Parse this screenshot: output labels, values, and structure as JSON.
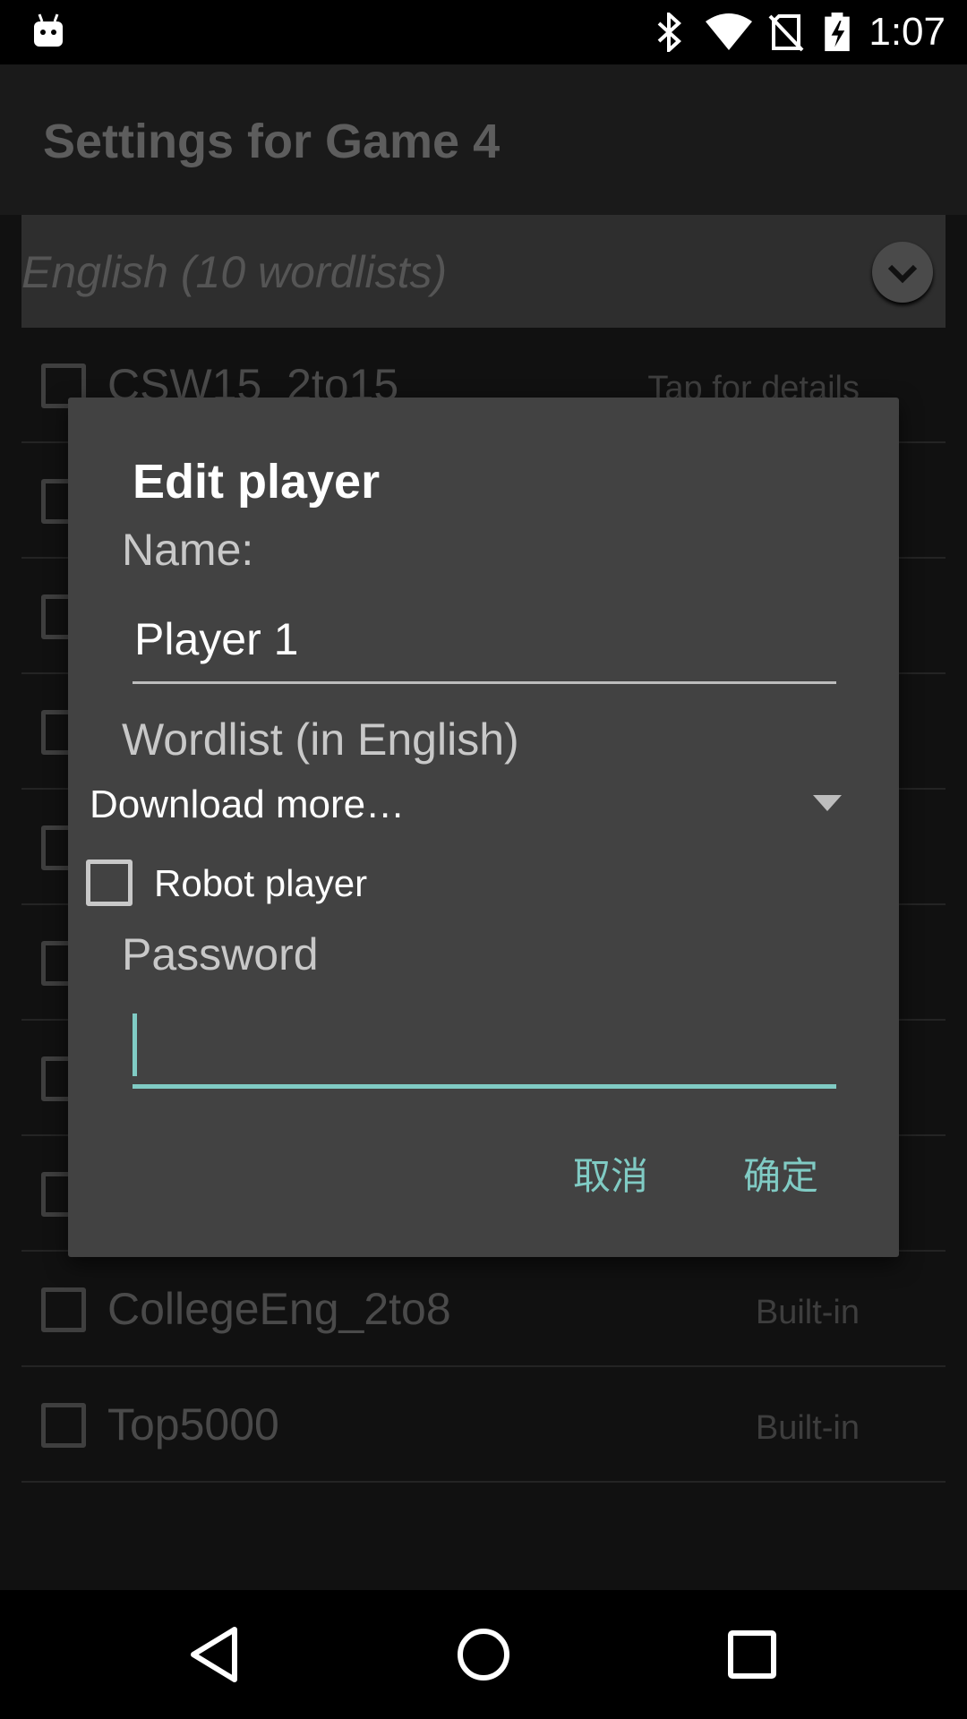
{
  "status_bar": {
    "time": "1:07",
    "icons": [
      "android-notification-icon",
      "bluetooth-icon",
      "wifi-icon",
      "no-sim-icon",
      "battery-charging-icon"
    ]
  },
  "app": {
    "title": "Settings for Game 4",
    "language_spinner": "English (10 wordlists)",
    "wordlists": [
      {
        "name": "CSW15_2to15",
        "status": "Tap for details"
      },
      {
        "name": "",
        "status": ""
      },
      {
        "name": "",
        "status": ""
      },
      {
        "name": "",
        "status": ""
      },
      {
        "name": "",
        "status": ""
      },
      {
        "name": "",
        "status": ""
      },
      {
        "name": "",
        "status": ""
      },
      {
        "name": "",
        "status": ""
      },
      {
        "name": "CollegeEng_2to8",
        "status": "Built-in"
      },
      {
        "name": "Top5000",
        "status": "Built-in"
      }
    ]
  },
  "dialog": {
    "title": "Edit player",
    "name_label": "Name:",
    "name_value": "Player 1",
    "wordlist_label": "Wordlist (in English)",
    "wordlist_selected": "Download more…",
    "robot_label": "Robot player",
    "robot_checked": false,
    "password_label": "Password",
    "password_value": "",
    "cancel_label": "取消",
    "ok_label": "确定",
    "accent_color": "#80cbc4"
  },
  "nav_bar": {
    "icons": [
      "back-icon",
      "home-icon",
      "recents-icon"
    ]
  }
}
